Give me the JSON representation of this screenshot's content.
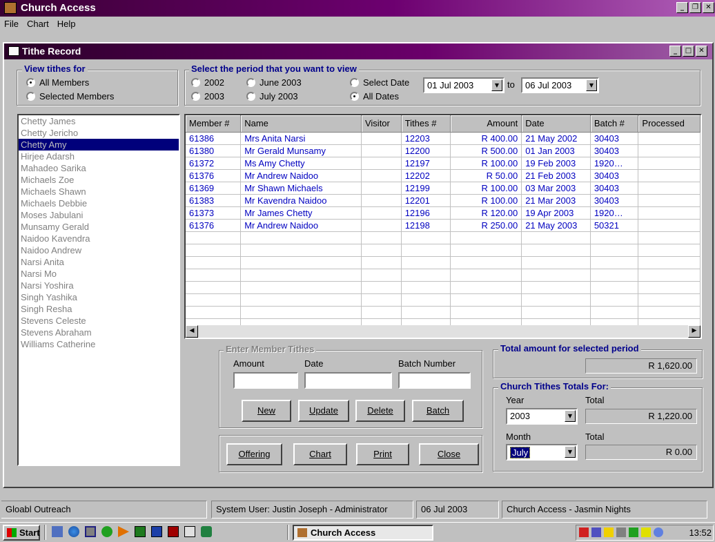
{
  "app": {
    "title": "Church Access"
  },
  "menubar": {
    "file": "File",
    "chart": "Chart",
    "help": "Help"
  },
  "window": {
    "title": "Tithe Record"
  },
  "view_group": {
    "title": "View tithes for",
    "all_members": "All Members",
    "selected_members": "Selected Members",
    "selected": "All Members"
  },
  "period_group": {
    "title": "Select the period that you want to view",
    "opt_2002": "2002",
    "opt_2003": "2003",
    "opt_june": "June 2003",
    "opt_july": "July 2003",
    "opt_select_date": "Select Date",
    "opt_all_dates": "All Dates",
    "selected": "All Dates",
    "from_date": "01 Jul 2003",
    "to_label": "to",
    "to_date": "06 Jul 2003"
  },
  "members": [
    "Chetty James",
    "Chetty Jericho",
    "Chetty Amy",
    "Hirjee Adarsh",
    "Mahadeo Sarika",
    "Michaels Zoe",
    "Michaels Shawn",
    "Michaels Debbie",
    "Moses Jabulani",
    "Munsamy Gerald",
    "Naidoo Kavendra",
    "Naidoo Andrew",
    "Narsi Anita",
    "Narsi Mo",
    "Narsi Yoshira",
    "Singh Yashika",
    "Singh Resha",
    "Stevens Celeste",
    "Stevens Abraham",
    "Williams Catherine"
  ],
  "selected_member": "Chetty Amy",
  "grid": {
    "columns": [
      "Member #",
      "Name",
      "Visitor",
      "Tithes #",
      "Amount",
      "Date",
      "Batch #",
      "Processed"
    ],
    "rows": [
      [
        "61386",
        "Mrs Anita Narsi",
        "",
        "12203",
        "R 400.00",
        "21 May 2002",
        "30403",
        ""
      ],
      [
        "61380",
        "Mr Gerald Munsamy",
        "",
        "12200",
        "R 500.00",
        "01 Jan 2003",
        "30403",
        ""
      ],
      [
        "61372",
        "Ms Amy Chetty",
        "",
        "12197",
        "R 100.00",
        "19 Feb 2003",
        "1920…",
        ""
      ],
      [
        "61376",
        "Mr Andrew Naidoo",
        "",
        "12202",
        "R 50.00",
        "21 Feb 2003",
        "30403",
        ""
      ],
      [
        "61369",
        "Mr Shawn Michaels",
        "",
        "12199",
        "R 100.00",
        "03 Mar 2003",
        "30403",
        ""
      ],
      [
        "61383",
        "Mr Kavendra Naidoo",
        "",
        "12201",
        "R 100.00",
        "21 Mar 2003",
        "30403",
        ""
      ],
      [
        "61373",
        "Mr James Chetty",
        "",
        "12196",
        "R 120.00",
        "19 Apr 2003",
        "1920…",
        ""
      ],
      [
        "61376",
        "Mr Andrew Naidoo",
        "",
        "12198",
        "R 250.00",
        "21 May 2003",
        "50321",
        ""
      ]
    ],
    "empty_rows": 8
  },
  "enter_tithes": {
    "title": "Enter Member Tithes",
    "amount_label": "Amount",
    "date_label": "Date",
    "batch_label": "Batch Number",
    "amount_value": "",
    "date_value": "",
    "batch_value": "",
    "new": "New",
    "update": "Update",
    "delete": "Delete",
    "batch": "Batch"
  },
  "actions": {
    "offering": "Offering",
    "chart": "Chart",
    "print": "Print",
    "close": "Close"
  },
  "total_period": {
    "title": "Total amount for selected period",
    "value": "R 1,620.00"
  },
  "church_totals": {
    "title": "Church Tithes Totals For:",
    "year_label": "Year",
    "year_value": "2003",
    "year_total_label": "Total",
    "year_total": "R 1,220.00",
    "month_label": "Month",
    "month_value": "July",
    "month_total_label": "Total",
    "month_total": "R 0.00"
  },
  "status": {
    "org": "Gloabl Outreach",
    "user": "System User: Justin Joseph - Administrator",
    "date": "06 Jul 2003",
    "app": "Church Access - Jasmin Nights"
  },
  "taskbar": {
    "start": "Start",
    "task": "Church Access",
    "clock": "13:52"
  }
}
